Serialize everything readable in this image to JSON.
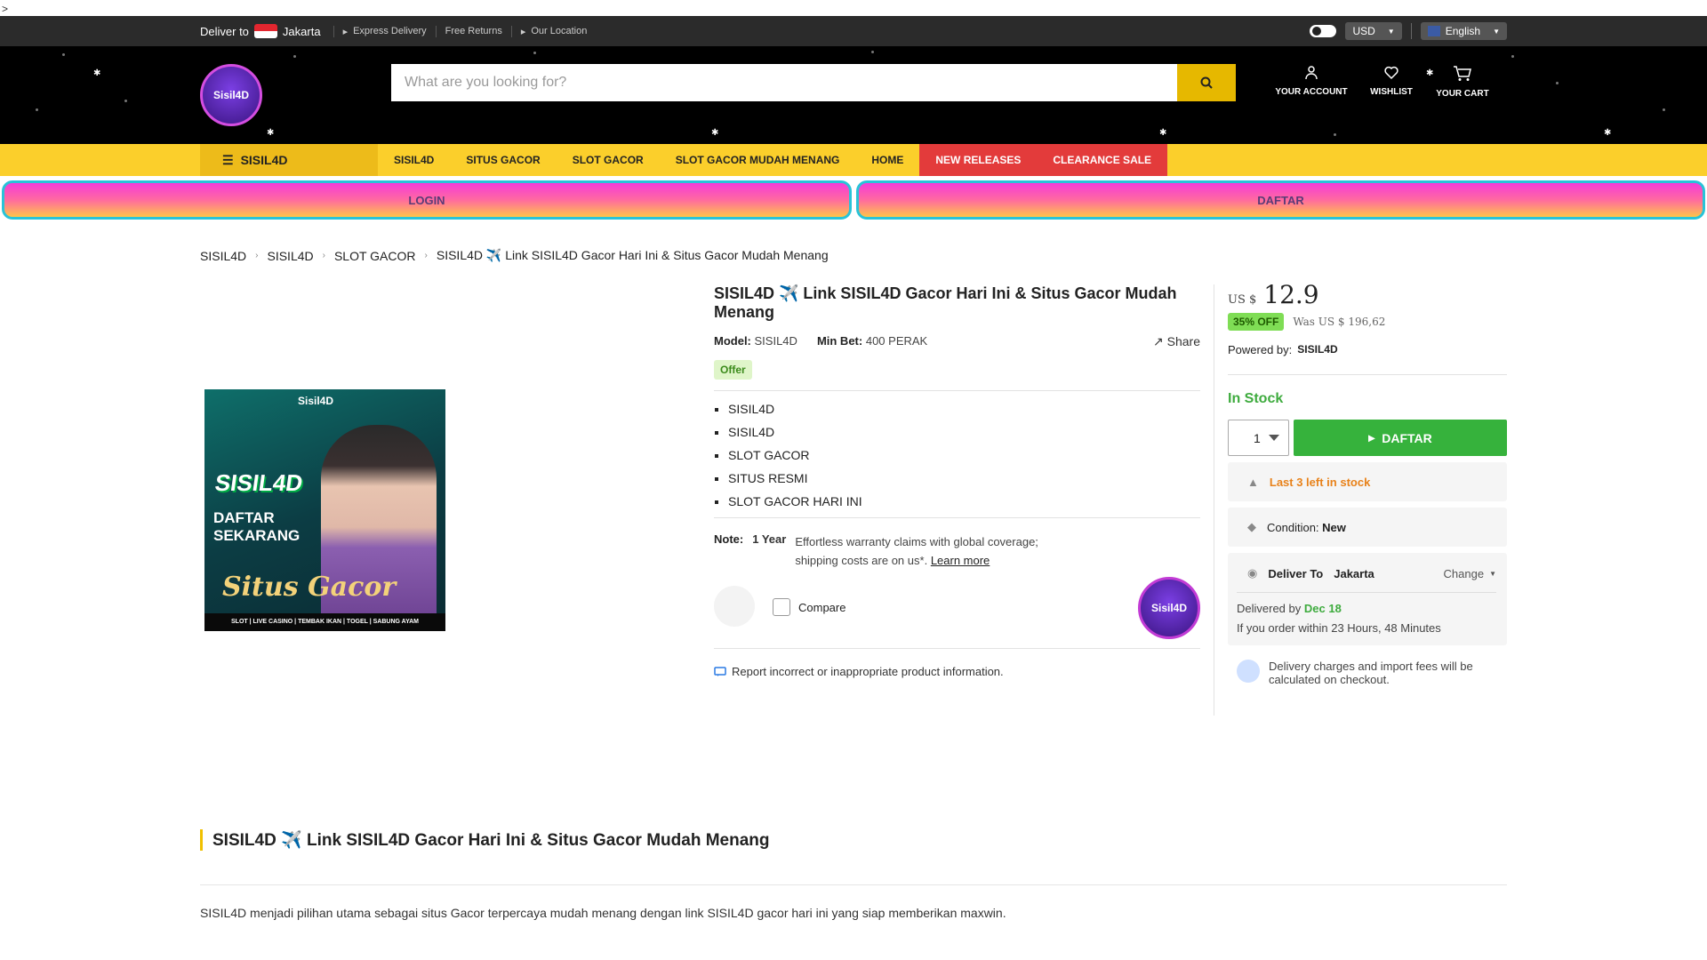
{
  "stray_text": ">",
  "topbar": {
    "deliver_label": "Deliver to",
    "deliver_city": "Jakarta",
    "links": [
      "Express Delivery",
      "Free Returns",
      "Our Location"
    ],
    "currency": "USD",
    "language": "English"
  },
  "header": {
    "logo_text": "Sisil4D",
    "search_placeholder": "What are you looking for?",
    "account_label": "YOUR ACCOUNT",
    "wishlist_label": "WISHLIST",
    "cart_label": "YOUR CART"
  },
  "nav": {
    "category": "SISIL4D",
    "items": [
      "SISIL4D",
      "SITUS GACOR",
      "SLOT GACOR",
      "SLOT GACOR MUDAH MENANG",
      "HOME"
    ],
    "red_items": [
      "NEW RELEASES",
      "CLEARANCE SALE"
    ]
  },
  "cta": {
    "login": "LOGIN",
    "daftar": "DAFTAR"
  },
  "breadcrumb": [
    "SISIL4D",
    "SISIL4D",
    "SLOT GACOR",
    "SISIL4D ✈️ Link SISIL4D Gacor Hari Ini & Situs Gacor Mudah Menang"
  ],
  "product_image": {
    "top_logo": "Sisil4D",
    "big_text": "SISIL4D",
    "daftar_text": "DAFTAR SEKARANG",
    "script_text": "Situs Gacor",
    "strip_text": "SLOT | LIVE CASINO | TEMBAK IKAN | TOGEL | SABUNG AYAM"
  },
  "product": {
    "title": "SISIL4D ✈️ Link SISIL4D Gacor Hari Ini & Situs Gacor Mudah Menang",
    "model_label": "Model:",
    "model_value": "SISIL4D",
    "minbet_label": "Min Bet:",
    "minbet_value": "400 PERAK",
    "share": "Share",
    "offer": "Offer",
    "bullets": [
      "SISIL4D",
      "SISIL4D",
      "SLOT GACOR",
      "SITUS RESMI",
      "SLOT GACOR HARI INI"
    ],
    "note_label": "Note:",
    "note_year": "1 Year",
    "note_text": "Effortless warranty claims with global coverage; shipping costs are on us*.",
    "note_link": "Learn more",
    "compare": "Compare",
    "seller_logo_text": "Sisil4D",
    "report": "Report incorrect or inappropriate product information."
  },
  "buybox": {
    "currency": "US $",
    "price": "12.9",
    "discount": "35% OFF",
    "was": "Was US $ 196,62",
    "powered_label": "Powered by:",
    "powered_value": "SISIL4D",
    "stock": "In Stock",
    "qty": "1",
    "daftar": "DAFTAR",
    "last_left": "Last 3 left in stock",
    "condition_label": "Condition:",
    "condition_value": "New",
    "deliver_to_label": "Deliver To",
    "deliver_to_city": "Jakarta",
    "change": "Change",
    "delivered_by_label": "Delivered by",
    "delivered_by_date": "Dec 18",
    "order_within": "If you order within 23 Hours, 48 Minutes",
    "fees": "Delivery charges and import fees will be calculated on checkout."
  },
  "description": {
    "title": "SISIL4D ✈️ Link SISIL4D Gacor Hari Ini & Situs Gacor Mudah Menang",
    "text": "SISIL4D menjadi pilihan utama sebagai situs Gacor terpercaya mudah menang dengan link SISIL4D gacor hari ini yang siap memberikan maxwin."
  },
  "colors": {
    "accent_yellow": "#fbcf2b",
    "red": "#e33b3b",
    "green": "#36b23c",
    "header_bg": "#000000"
  }
}
